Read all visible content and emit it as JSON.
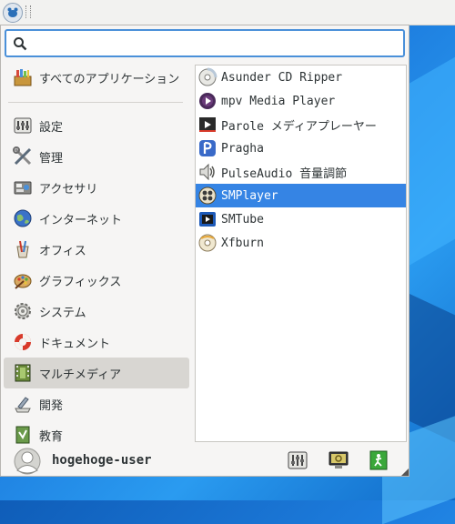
{
  "search": {
    "value": "",
    "placeholder": ""
  },
  "categories": [
    {
      "label": "すべてのアプリケーション",
      "icon": "all-apps-icon"
    },
    {
      "label": "設定",
      "icon": "settings-icon"
    },
    {
      "label": "管理",
      "icon": "admin-tools-icon"
    },
    {
      "label": "アクセサリ",
      "icon": "accessories-icon"
    },
    {
      "label": "インターネット",
      "icon": "internet-globe-icon"
    },
    {
      "label": "オフィス",
      "icon": "office-icon"
    },
    {
      "label": "グラフィックス",
      "icon": "graphics-palette-icon"
    },
    {
      "label": "システム",
      "icon": "system-gear-icon"
    },
    {
      "label": "ドキュメント",
      "icon": "help-lifebuoy-icon"
    },
    {
      "label": "マルチメディア",
      "icon": "multimedia-film-icon"
    },
    {
      "label": "開発",
      "icon": "development-icon"
    },
    {
      "label": "教育",
      "icon": "education-icon"
    }
  ],
  "active_category": "マルチメディア",
  "apps": [
    {
      "label": "Asunder CD Ripper",
      "icon": "cd-icon"
    },
    {
      "label": "mpv Media Player",
      "icon": "mpv-icon"
    },
    {
      "label": "Parole メディアプレーヤー",
      "icon": "parole-player-icon"
    },
    {
      "label": "Pragha",
      "icon": "pragha-icon"
    },
    {
      "label": "PulseAudio 音量調節",
      "icon": "speaker-icon"
    },
    {
      "label": "SMPlayer",
      "icon": "smplayer-icon"
    },
    {
      "label": "SMTube",
      "icon": "smtube-icon"
    },
    {
      "label": "Xfburn",
      "icon": "disc-burn-icon"
    }
  ],
  "selected_app": "SMPlayer",
  "user": {
    "name": "hogehoge-user"
  },
  "footer_buttons": [
    "settings-manager-icon",
    "lock-screen-icon",
    "logout-icon"
  ],
  "colors": {
    "selection": "#3584e4",
    "active_category": "#d8d6d2",
    "search_border": "#4a90d9"
  }
}
